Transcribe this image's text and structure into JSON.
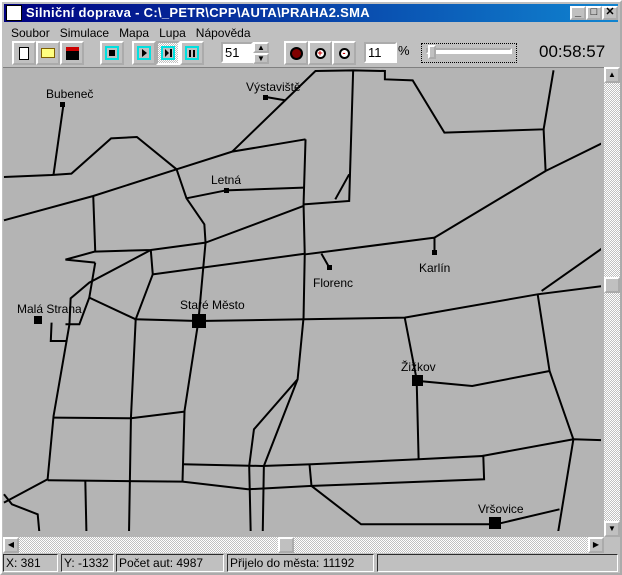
{
  "window": {
    "title": "Silniční doprava  -  C:\\_PETR\\CPP\\AUTA\\PRAHA2.SMA",
    "minimize": "_",
    "maximize": "□",
    "close": "✕"
  },
  "menu": [
    "Soubor",
    "Simulace",
    "Mapa",
    "Lupa",
    "Nápověda"
  ],
  "toolbar": {
    "speed_value": "51",
    "zoom_value": "11",
    "zoom_unit": "%",
    "slider_level": 0.05,
    "clock": "00:58:57",
    "icons": [
      "new-file-icon",
      "open-folder-icon",
      "save-icon",
      "stop-icon",
      "play-icon",
      "step-icon",
      "pause-icon",
      "record-icon",
      "zoom-in-icon",
      "zoom-out-icon"
    ],
    "active_button": "step"
  },
  "map": {
    "places": [
      "Bubeneč",
      "Výstaviště",
      "Letná",
      "Florenc",
      "Karlín",
      "Malá Strana",
      "Staré Město",
      "Žižkov",
      "Vršovice"
    ],
    "road_color": "#000000",
    "background": "#b4b4b4"
  },
  "status": {
    "x": "X: 381",
    "y": "Y: -1332",
    "cars": "Počet aut: 4987",
    "arrived": "Přijelo do města: 11192"
  }
}
